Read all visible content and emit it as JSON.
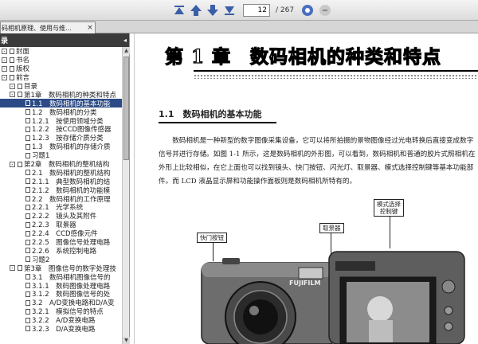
{
  "toolbar": {
    "icons": [
      "first-page-icon",
      "previous-page-icon",
      "next-page-icon",
      "last-page-icon",
      "zoom-in-icon",
      "zoom-out-icon"
    ],
    "current_page": "12",
    "total_pages": "/ 267"
  },
  "tab": {
    "title": "码相机原理、使用与维...",
    "close": "×"
  },
  "panel": {
    "title": "录",
    "close_glyph": "◂",
    "bookmarks": [
      {
        "label": "封面",
        "level": 0,
        "expander": "-"
      },
      {
        "label": "书名",
        "level": 0,
        "expander": "-"
      },
      {
        "label": "版权",
        "level": 0,
        "expander": "-"
      },
      {
        "label": "前言",
        "level": 0,
        "expander": "-"
      },
      {
        "label": "目录",
        "level": 1,
        "expander": "-"
      },
      {
        "label": "第1章　数码相机的种类和特点",
        "level": 1,
        "expander": "-"
      },
      {
        "label": "1.1　数码相机的基本功能",
        "level": 2,
        "expander": "",
        "selected": true
      },
      {
        "label": "1.2　数码相机的分类",
        "level": 2,
        "expander": ""
      },
      {
        "label": "1.2.1　按使用领域分类",
        "level": 2,
        "expander": ""
      },
      {
        "label": "1.2.2　按CCD图像传感器",
        "level": 2,
        "expander": ""
      },
      {
        "label": "1.2.3　按存储介质分类",
        "level": 2,
        "expander": ""
      },
      {
        "label": "1.3　数码相机的存储介质",
        "level": 2,
        "expander": ""
      },
      {
        "label": "习题1",
        "level": 2,
        "expander": ""
      },
      {
        "label": "第2章　数码相机的整机结构",
        "level": 1,
        "expander": "-"
      },
      {
        "label": "2.1　数码相机的整机结构",
        "level": 2,
        "expander": ""
      },
      {
        "label": "2.1.1　典型数码相机的结",
        "level": 2,
        "expander": ""
      },
      {
        "label": "2.1.2　数码相机的功能模",
        "level": 2,
        "expander": ""
      },
      {
        "label": "2.2　数码相机的工作原理",
        "level": 2,
        "expander": ""
      },
      {
        "label": "2.2.1　光学系统",
        "level": 2,
        "expander": ""
      },
      {
        "label": "2.2.2　镜头及其附件",
        "level": 2,
        "expander": ""
      },
      {
        "label": "2.2.3　取景器",
        "level": 2,
        "expander": ""
      },
      {
        "label": "2.2.4　CCD感像元件",
        "level": 2,
        "expander": ""
      },
      {
        "label": "2.2.5　图像信号处理电路",
        "level": 2,
        "expander": ""
      },
      {
        "label": "2.2.6　系统控制电路",
        "level": 2,
        "expander": ""
      },
      {
        "label": "习题2",
        "level": 2,
        "expander": ""
      },
      {
        "label": "第3章　图像信号的数字处理技",
        "level": 1,
        "expander": "-"
      },
      {
        "label": "3.1　数码相机图像信号的",
        "level": 2,
        "expander": ""
      },
      {
        "label": "3.1.1　数码图像处理电路",
        "level": 2,
        "expander": ""
      },
      {
        "label": "3.1.2　数码图像信号的处",
        "level": 2,
        "expander": ""
      },
      {
        "label": "3.2　A/D变换电路和D/A变",
        "level": 2,
        "expander": ""
      },
      {
        "label": "3.2.1　模拟信号的特点",
        "level": 2,
        "expander": ""
      },
      {
        "label": "3.2.2　A/D变换电路",
        "level": 2,
        "expander": ""
      },
      {
        "label": "3.2.3　D/A变换电路",
        "level": 2,
        "expander": ""
      }
    ]
  },
  "page": {
    "chapter_title": "第 1 章　数码相机的种类和特点",
    "section_title": "1.1　数码相机的基本功能",
    "paragraph": "数码相机是一种新型的数字图像采集设备，它可以将所拍摄的景物图像经过光电转换后直接变成数字信号并进行存储。如图 1-1 所示，这是数码相机的外形图，可以看到，数码相机和普通的胶片式照相机在外形上比较相似，在它上面也可以找到镜头、快门按钮、闪光灯、取景器、模式选择控制键等基本功能部件。而 LCD 液晶显示屏和功能操作面板则是数码相机所特有的。",
    "callouts": {
      "shutter": "快门按钮",
      "viewfinder": "取景器",
      "mode": "模式选择\n控制键",
      "brand": "FUJIFILM"
    }
  },
  "colors": {
    "selection": "#2b4a86",
    "panel_header": "#3b3b3b",
    "nav_icon": "#3a5fa8"
  }
}
